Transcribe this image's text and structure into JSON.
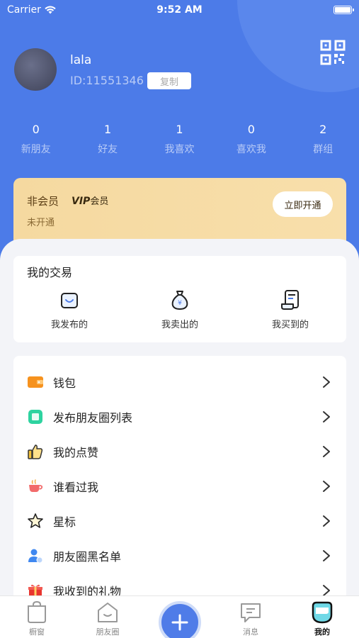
{
  "status_bar": {
    "carrier": "Carrier",
    "time": "9:52 AM"
  },
  "profile": {
    "name": "lala",
    "id": "ID:11551346",
    "copy_label": "复制"
  },
  "stats": [
    {
      "value": "0",
      "label": "新朋友"
    },
    {
      "value": "1",
      "label": "好友"
    },
    {
      "value": "1",
      "label": "我喜欢"
    },
    {
      "value": "0",
      "label": "喜欢我"
    },
    {
      "value": "2",
      "label": "群组"
    }
  ],
  "vip": {
    "title": "非会员",
    "logo_mark": "VIP",
    "logo_text": "会员",
    "status": "未开通",
    "button": "立即开通"
  },
  "trade": {
    "title": "我的交易",
    "items": [
      {
        "label": "我发布的",
        "icon": "bag-icon"
      },
      {
        "label": "我卖出的",
        "icon": "money-bag-icon"
      },
      {
        "label": "我买到的",
        "icon": "receipt-icon"
      }
    ]
  },
  "menu": [
    {
      "label": "钱包",
      "icon": "wallet-icon"
    },
    {
      "label": "发布朋友圈列表",
      "icon": "moments-list-icon"
    },
    {
      "label": "我的点赞",
      "icon": "thumbs-up-icon"
    },
    {
      "label": "谁看过我",
      "icon": "coffee-cup-icon"
    },
    {
      "label": "星标",
      "icon": "star-icon"
    },
    {
      "label": "朋友圈黑名单",
      "icon": "user-block-icon"
    },
    {
      "label": "我收到的礼物",
      "icon": "gift-icon"
    }
  ],
  "tabbar": [
    {
      "label": "橱窗",
      "icon": "shopping-bag-icon"
    },
    {
      "label": "朋友圈",
      "icon": "house-icon"
    },
    {
      "label": "消息",
      "icon": "message-icon"
    },
    {
      "label": "我的",
      "icon": "profile-icon"
    }
  ],
  "colors": {
    "primary": "#4c7be8",
    "vip_gold": "#f5d9a0",
    "background": "#f3f4f8"
  }
}
